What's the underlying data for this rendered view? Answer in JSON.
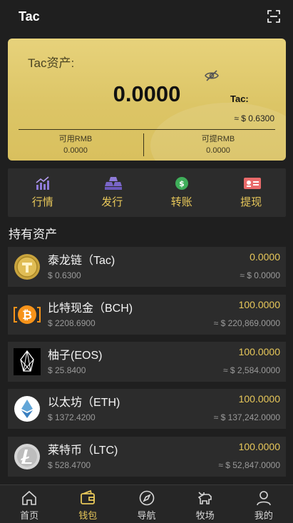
{
  "header": {
    "title": "Tac"
  },
  "card": {
    "asset_label": "Tac资产:",
    "balance": "0.0000",
    "tac_label": "Tac:",
    "tac_value": "≈ $ 0.6300",
    "available_rmb_label": "可用RMB",
    "available_rmb_value": "0.0000",
    "withdrawable_rmb_label": "可提RMB",
    "withdrawable_rmb_value": "0.0000"
  },
  "actions": [
    {
      "label": "行情",
      "icon": "chart-icon"
    },
    {
      "label": "发行",
      "icon": "gold-bars-icon"
    },
    {
      "label": "转账",
      "icon": "coin-transfer-icon"
    },
    {
      "label": "提现",
      "icon": "id-card-icon"
    }
  ],
  "section_title": "持有资产",
  "assets": [
    {
      "name": "泰龙链（Tac)",
      "price": "$ 0.6300",
      "amount": "0.0000",
      "value": "≈ $ 0.0000",
      "icon": "tac-coin-icon"
    },
    {
      "name": "比特现金（BCH)",
      "price": "$ 2208.6900",
      "amount": "100.0000",
      "value": "≈ $ 220,869.0000",
      "icon": "bitcoin-cash-icon"
    },
    {
      "name": "柚子(EOS)",
      "price": "$ 25.8400",
      "amount": "100.0000",
      "value": "≈ $ 2,584.0000",
      "icon": "eos-icon"
    },
    {
      "name": "以太坊（ETH)",
      "price": "$ 1372.4200",
      "amount": "100.0000",
      "value": "≈ $ 137,242.0000",
      "icon": "ethereum-icon"
    },
    {
      "name": "莱特币（LTC)",
      "price": "$ 528.4700",
      "amount": "100.0000",
      "value": "≈ $ 52,847.0000",
      "icon": "litecoin-icon"
    }
  ],
  "bottom_nav": [
    {
      "label": "首页",
      "icon": "home-icon",
      "active": false
    },
    {
      "label": "钱包",
      "icon": "wallet-icon",
      "active": true
    },
    {
      "label": "导航",
      "icon": "compass-icon",
      "active": false
    },
    {
      "label": "牧场",
      "icon": "cow-icon",
      "active": false
    },
    {
      "label": "我的",
      "icon": "user-icon",
      "active": false
    }
  ],
  "colors": {
    "accent": "#e8c85a",
    "card_gold": "#dcc566",
    "background": "#1f1f1f",
    "panel": "#2c2c2c"
  }
}
